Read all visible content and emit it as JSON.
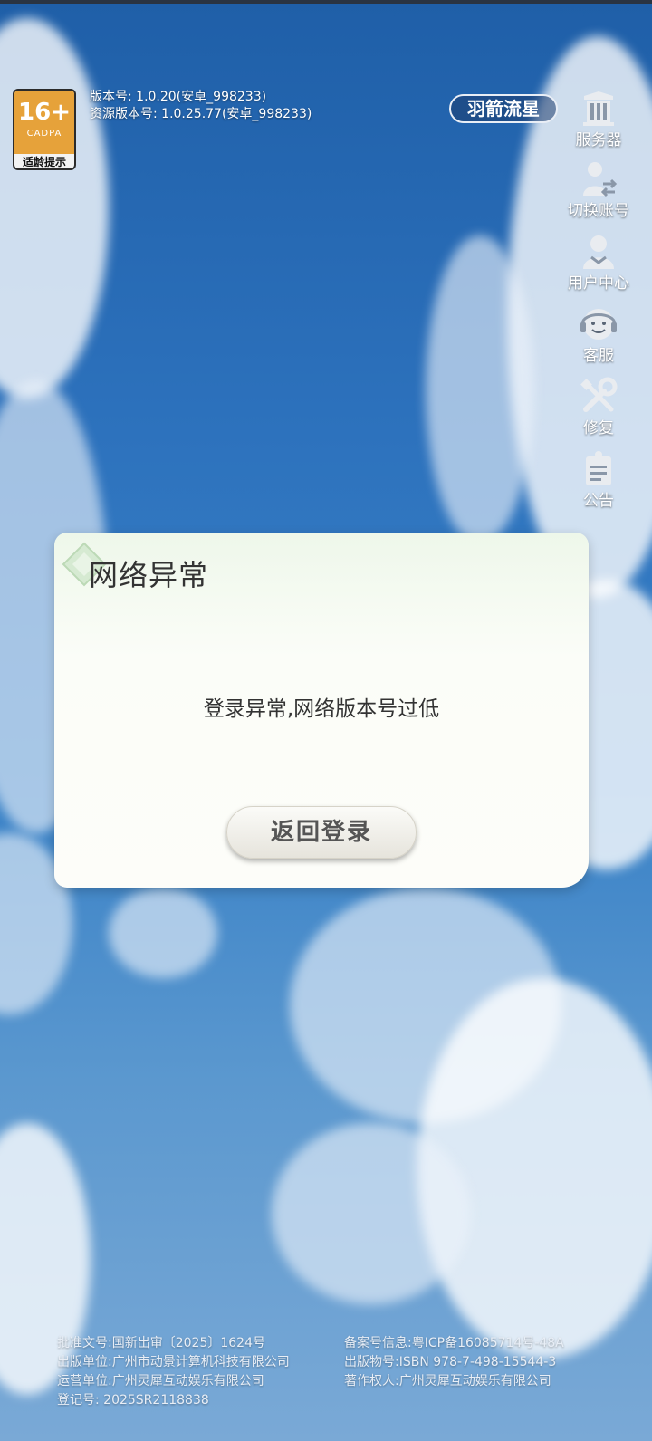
{
  "age_badge": {
    "age": "16+",
    "org": "CADPA",
    "label": "适龄提示"
  },
  "version": {
    "app": "版本号: 1.0.20(安卓_998233)",
    "resource": "资源版本号: 1.0.25.77(安卓_998233)"
  },
  "server_name": "羽箭流星",
  "sidebar": {
    "items": [
      {
        "label": "服务器",
        "icon": "server-icon"
      },
      {
        "label": "切换账号",
        "icon": "switch-account-icon"
      },
      {
        "label": "用户中心",
        "icon": "user-center-icon"
      },
      {
        "label": "客服",
        "icon": "customer-service-icon"
      },
      {
        "label": "修复",
        "icon": "repair-icon"
      },
      {
        "label": "公告",
        "icon": "announcement-icon"
      }
    ]
  },
  "dialog": {
    "title": "网络异常",
    "message": "登录异常,网络版本号过低",
    "button": "返回登录"
  },
  "footer": {
    "left": [
      "批准文号:国新出审〔2025〕1624号",
      "出版单位:广州市动景计算机科技有限公司",
      "运营单位:广州灵犀互动娱乐有限公司",
      "登记号: 2025SR2118838"
    ],
    "right": [
      "备案号信息:粤ICP备16085714号-48A",
      "出版物号:ISBN 978-7-498-15544-3",
      "著作权人:广州灵犀互动娱乐有限公司"
    ]
  }
}
